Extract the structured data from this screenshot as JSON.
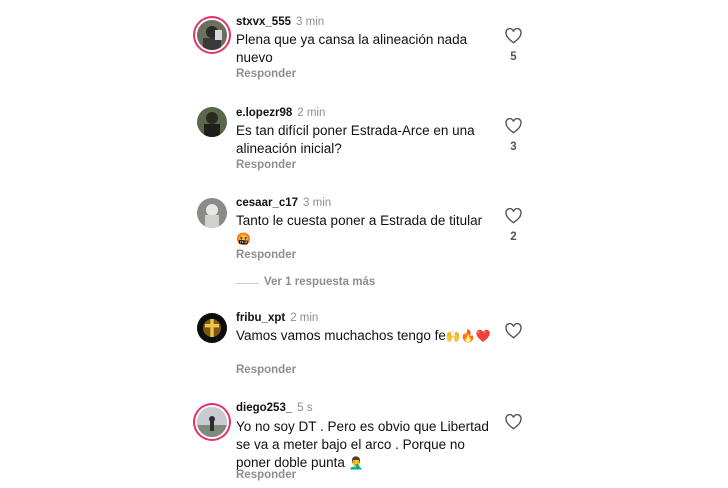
{
  "comments": [
    {
      "username": "stxvx_555",
      "time": "3 min",
      "text": "Plena que ya cansa la alineación nada nuevo",
      "likes": "5",
      "reply_label": "Responder"
    },
    {
      "username": "e.lopezr98",
      "time": "2 min",
      "text": "Es tan difícil poner Estrada-Arce en una alineación inicial?",
      "likes": "3",
      "reply_label": "Responder"
    },
    {
      "username": "cesaar_c17",
      "time": "3 min",
      "text": "Tanto le cuesta poner a Estrada de titular",
      "emoji": "🤬",
      "likes": "2",
      "reply_label": "Responder"
    },
    {
      "username": "fribu_xpt",
      "time": "2 min",
      "text": "Vamos vamos muchachos tengo fe",
      "emoji": "🙌🔥❤️",
      "likes": "",
      "reply_label": "Responder"
    },
    {
      "username": "diego253_",
      "time": "5 s",
      "text": "Yo no soy DT . Pero es obvio que Libertad se va a meter bajo el arco . Porque no poner doble punta",
      "emoji": "🤦‍♂️",
      "likes": "",
      "reply_label": "Responder"
    }
  ],
  "view_more_replies": "Ver 1 respuesta más",
  "colors": {
    "muted": "#8e8e8e",
    "story_ring": "#e1306c",
    "text": "#111111"
  }
}
